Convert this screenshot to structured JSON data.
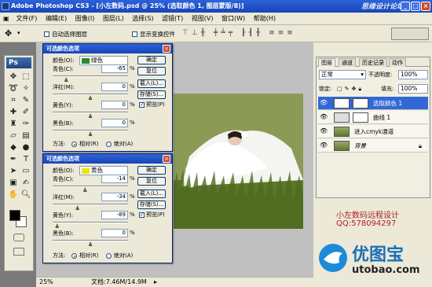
{
  "window": {
    "title": "Adobe Photoshop CS3 - [小左数码.psd @ 25% (选取颜色 1, 图层蒙版/8)]",
    "top_watermark": "思缘设计论坛"
  },
  "menu": [
    "文件(F)",
    "编辑(E)",
    "图像(I)",
    "图层(L)",
    "选择(S)",
    "滤镜(T)",
    "视图(V)",
    "窗口(W)",
    "帮助(H)"
  ],
  "options_bar": {
    "auto_select": "自动选择图层",
    "show_transform": "显示变换控件"
  },
  "dialog1": {
    "title": "可选颜色选项",
    "color_label": "颜色(O):",
    "color_value": "绿色",
    "color_swatch": "#2a8a2a",
    "sliders": [
      {
        "label": "青色(C):",
        "value": "-65"
      },
      {
        "label": "洋红(M):",
        "value": "0"
      },
      {
        "label": "黄色(Y):",
        "value": "0"
      },
      {
        "label": "黑色(B):",
        "value": "0"
      }
    ],
    "slider_levels": [
      0.18,
      0.5,
      0.5,
      0.5
    ],
    "pct": "%",
    "buttons": {
      "ok": "确定",
      "reset": "复位",
      "load": "载入(L)...",
      "save": "存储(S)..."
    },
    "preview": "预览(P)",
    "method_label": "方法:",
    "relative": "相对(R)",
    "absolute": "绝对(A)"
  },
  "dialog2": {
    "title": "可选颜色选项",
    "color_label": "颜色(O):",
    "color_value": "黄色",
    "color_swatch": "#f0e010",
    "sliders": [
      {
        "label": "青色(C):",
        "value": "-14"
      },
      {
        "label": "洋红(M):",
        "value": "-34"
      },
      {
        "label": "黄色(Y):",
        "value": "-89"
      },
      {
        "label": "黑色(B):",
        "value": "0"
      }
    ],
    "slider_levels": [
      0.43,
      0.33,
      0.06,
      0.5
    ],
    "pct": "%",
    "buttons": {
      "ok": "确定",
      "reset": "复位",
      "load": "载入(L)...",
      "save": "存储(S)..."
    },
    "preview": "预览(P)",
    "method_label": "方法:",
    "relative": "相对(R)",
    "absolute": "绝对(A)"
  },
  "layers_panel": {
    "tabs": [
      "图层",
      "通道",
      "历史记录",
      "动作"
    ],
    "blend_mode": "正常",
    "opacity_label": "不透明度:",
    "opacity": "100%",
    "lock_label": "锁定:",
    "fill_label": "填充:",
    "fill": "100%",
    "layers": [
      {
        "name": "选取颜色 1",
        "selected": true
      },
      {
        "name": "曲线 1",
        "selected": false
      },
      {
        "name": "进入cmyk通道",
        "selected": false
      },
      {
        "name": "背景",
        "selected": false
      }
    ]
  },
  "status": {
    "zoom": "25%",
    "doc": "文档:7.46M/14.9M"
  },
  "credits": {
    "line1": "小左数码远程设计",
    "line2": "QQ:578094297",
    "logo_text": "优图宝",
    "logo_url": "utobao.com"
  },
  "colors": {
    "title_blue": "#1744b8",
    "selection_blue": "#3168d5",
    "credit_red": "#b02020",
    "logo_blue": "#1c8ad8"
  }
}
